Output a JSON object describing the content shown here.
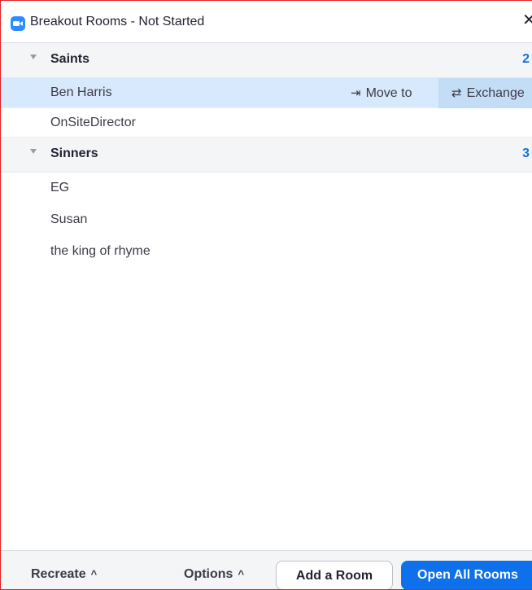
{
  "window": {
    "title": "Breakout Rooms - Not Started",
    "close_glyph": "✕",
    "app_icon": "zoom-camera-icon"
  },
  "rooms": [
    {
      "name": "Saints",
      "count": "2",
      "participants": [
        "Ben Harris",
        "OnSiteDirector"
      ]
    },
    {
      "name": "Sinners",
      "count": "3",
      "participants": [
        "EG",
        "Susan",
        "the king of rhyme"
      ]
    }
  ],
  "row_actions": {
    "move_to": "Move to",
    "exchange": "Exchange",
    "move_icon": "⇥",
    "exchange_icon": "⇄"
  },
  "footer": {
    "recreate": "Recreate",
    "options": "Options",
    "add_room": "Add a Room",
    "open_all": "Open All Rooms",
    "up_glyph": "^"
  },
  "colors": {
    "accent": "#0e71eb",
    "selected_row": "#d7e9fc",
    "header_bg": "#f4f5f7",
    "window_border": "#e02020"
  }
}
